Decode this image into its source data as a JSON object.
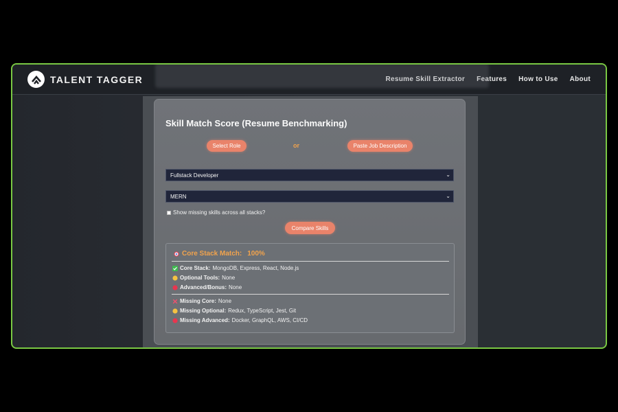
{
  "brand": {
    "name": "TALENT TAGGER"
  },
  "nav": {
    "items": [
      "Resume Skill Extractor",
      "Features",
      "How to Use",
      "About"
    ]
  },
  "card": {
    "title": "Skill Match Score (Resume Benchmarking)",
    "select_role_label": "Select Role",
    "or_text": "or",
    "paste_jd_label": "Paste Job Description",
    "role_select_value": "Fullstack Developer",
    "stack_select_value": "MERN",
    "checkbox_label": "Show missing skills across all stacks?",
    "compare_label": "Compare Skills"
  },
  "results": {
    "title": "Core Stack Match:",
    "percent": "100%",
    "core_stack_label": "Core Stack:",
    "core_stack_value": "MongoDB, Express, React, Node.js",
    "optional_tools_label": "Optional Tools:",
    "optional_tools_value": "None",
    "advanced_label": "Advanced/Bonus:",
    "advanced_value": "None",
    "missing_core_label": "Missing Core:",
    "missing_core_value": "None",
    "missing_optional_label": "Missing Optional:",
    "missing_optional_value": "Redux, TypeScript, Jest, Git",
    "missing_advanced_label": "Missing Advanced:",
    "missing_advanced_value": "Docker, GraphQL, AWS, CI/CD"
  },
  "colors": {
    "accent": "#e9836a",
    "frame_border": "#7ac943",
    "score": "#f2a34c"
  },
  "icons": [
    "target-icon",
    "check-icon",
    "yellow-circle-icon",
    "red-circle-icon",
    "cross-icon"
  ]
}
